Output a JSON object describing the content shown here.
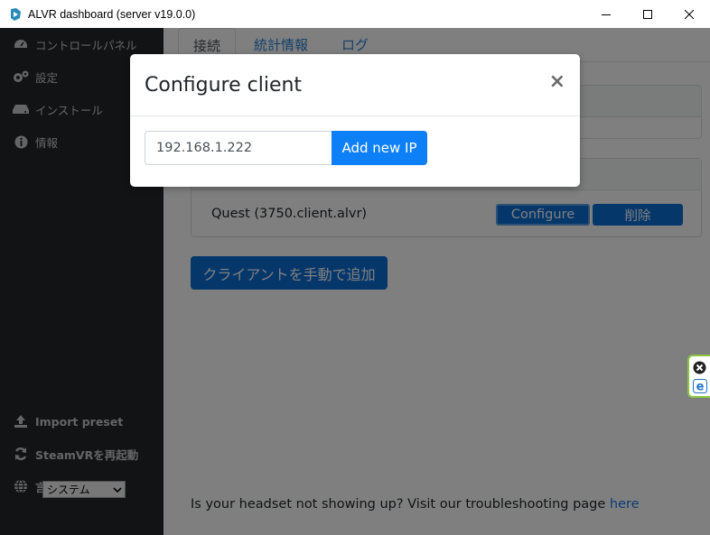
{
  "window": {
    "title": "ALVR dashboard (server v19.0.0)"
  },
  "sidebar": {
    "items": [
      {
        "label": "コントロールパネル",
        "icon": "dashboard-icon"
      },
      {
        "label": "設定",
        "icon": "cogs-icon"
      },
      {
        "label": "インストール",
        "icon": "hdd-icon"
      },
      {
        "label": "情報",
        "icon": "info-icon"
      }
    ],
    "bottom_items": [
      {
        "label": "Import preset",
        "icon": "upload-icon"
      },
      {
        "label": "SteamVRを再起動",
        "icon": "sync-icon"
      },
      {
        "label": "言語",
        "icon": "globe-icon"
      }
    ],
    "language_select": {
      "value": "システム"
    }
  },
  "tabs": [
    {
      "label": "接続"
    },
    {
      "label": "統計情報"
    },
    {
      "label": "ログ"
    }
  ],
  "client": {
    "name": "Quest (3750.client.alvr)",
    "configure_label": "Configure",
    "delete_label": "削除"
  },
  "add_client_label": "クライアントを手動で追加",
  "footer": {
    "text": "Is your headset not showing up? Visit our troubleshooting page ",
    "link": "here"
  },
  "modal": {
    "title": "Configure client",
    "close_glyph": "×",
    "ip_value": "192.168.1.222",
    "add_ip_label": "Add new IP"
  },
  "colors": {
    "sidebar_bg": "#242628",
    "primary": "#0d7ff7",
    "link": "#1a73e8"
  }
}
